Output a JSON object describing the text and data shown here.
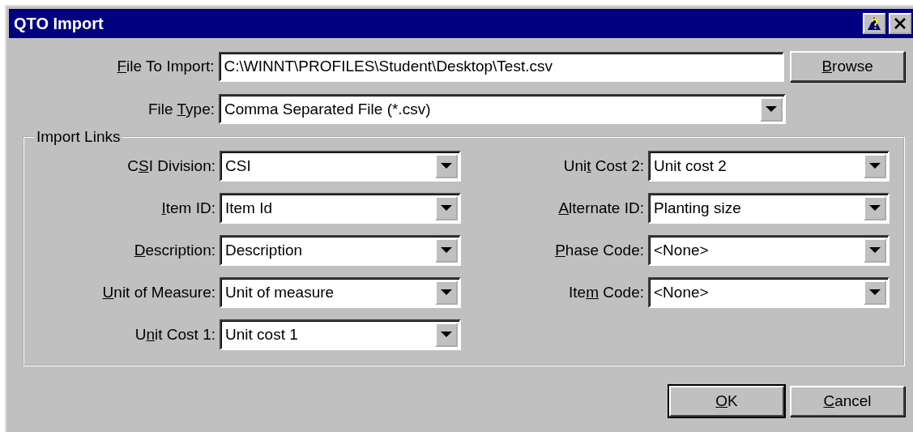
{
  "window": {
    "title": "QTO Import"
  },
  "file_to_import": {
    "label": {
      "key": "F",
      "post": "ile To Import:"
    },
    "value": "C:\\WINNT\\PROFILES\\Student\\Desktop\\Test.csv",
    "button": {
      "key": "B",
      "post": "rowse"
    }
  },
  "file_type": {
    "label": {
      "pre": "File ",
      "key": "T",
      "post": "ype:"
    },
    "value": "Comma Separated File (*.csv)"
  },
  "import_links": {
    "title": "Import Links",
    "left": [
      {
        "label": {
          "pre": "C",
          "key": "S",
          "post": "I Division:"
        },
        "value": "CSI"
      },
      {
        "label": {
          "key": "I",
          "post": "tem ID:"
        },
        "value": "Item Id"
      },
      {
        "label": {
          "key": "D",
          "post": "escription:"
        },
        "value": "Description"
      },
      {
        "label": {
          "key": "U",
          "post": "nit of Measure:"
        },
        "value": "Unit of measure"
      },
      {
        "label": {
          "pre": "U",
          "key": "n",
          "post": "it Cost 1:"
        },
        "value": "Unit cost 1"
      }
    ],
    "right": [
      {
        "label": {
          "pre": "Uni",
          "key": "t",
          "post": " Cost 2:"
        },
        "value": "Unit cost 2"
      },
      {
        "label": {
          "key": "A",
          "post": "lternate ID:"
        },
        "value": "Planting size"
      },
      {
        "label": {
          "key": "P",
          "post": "hase Code:"
        },
        "value": "<None>"
      },
      {
        "label": {
          "pre": "Ite",
          "key": "m",
          "post": " Code:"
        },
        "value": "<None>"
      }
    ]
  },
  "buttons": [
    {
      "label": {
        "key": "O",
        "post": "K"
      },
      "default": true
    },
    {
      "label": {
        "key": "C",
        "post": "ancel"
      },
      "default": false
    }
  ]
}
